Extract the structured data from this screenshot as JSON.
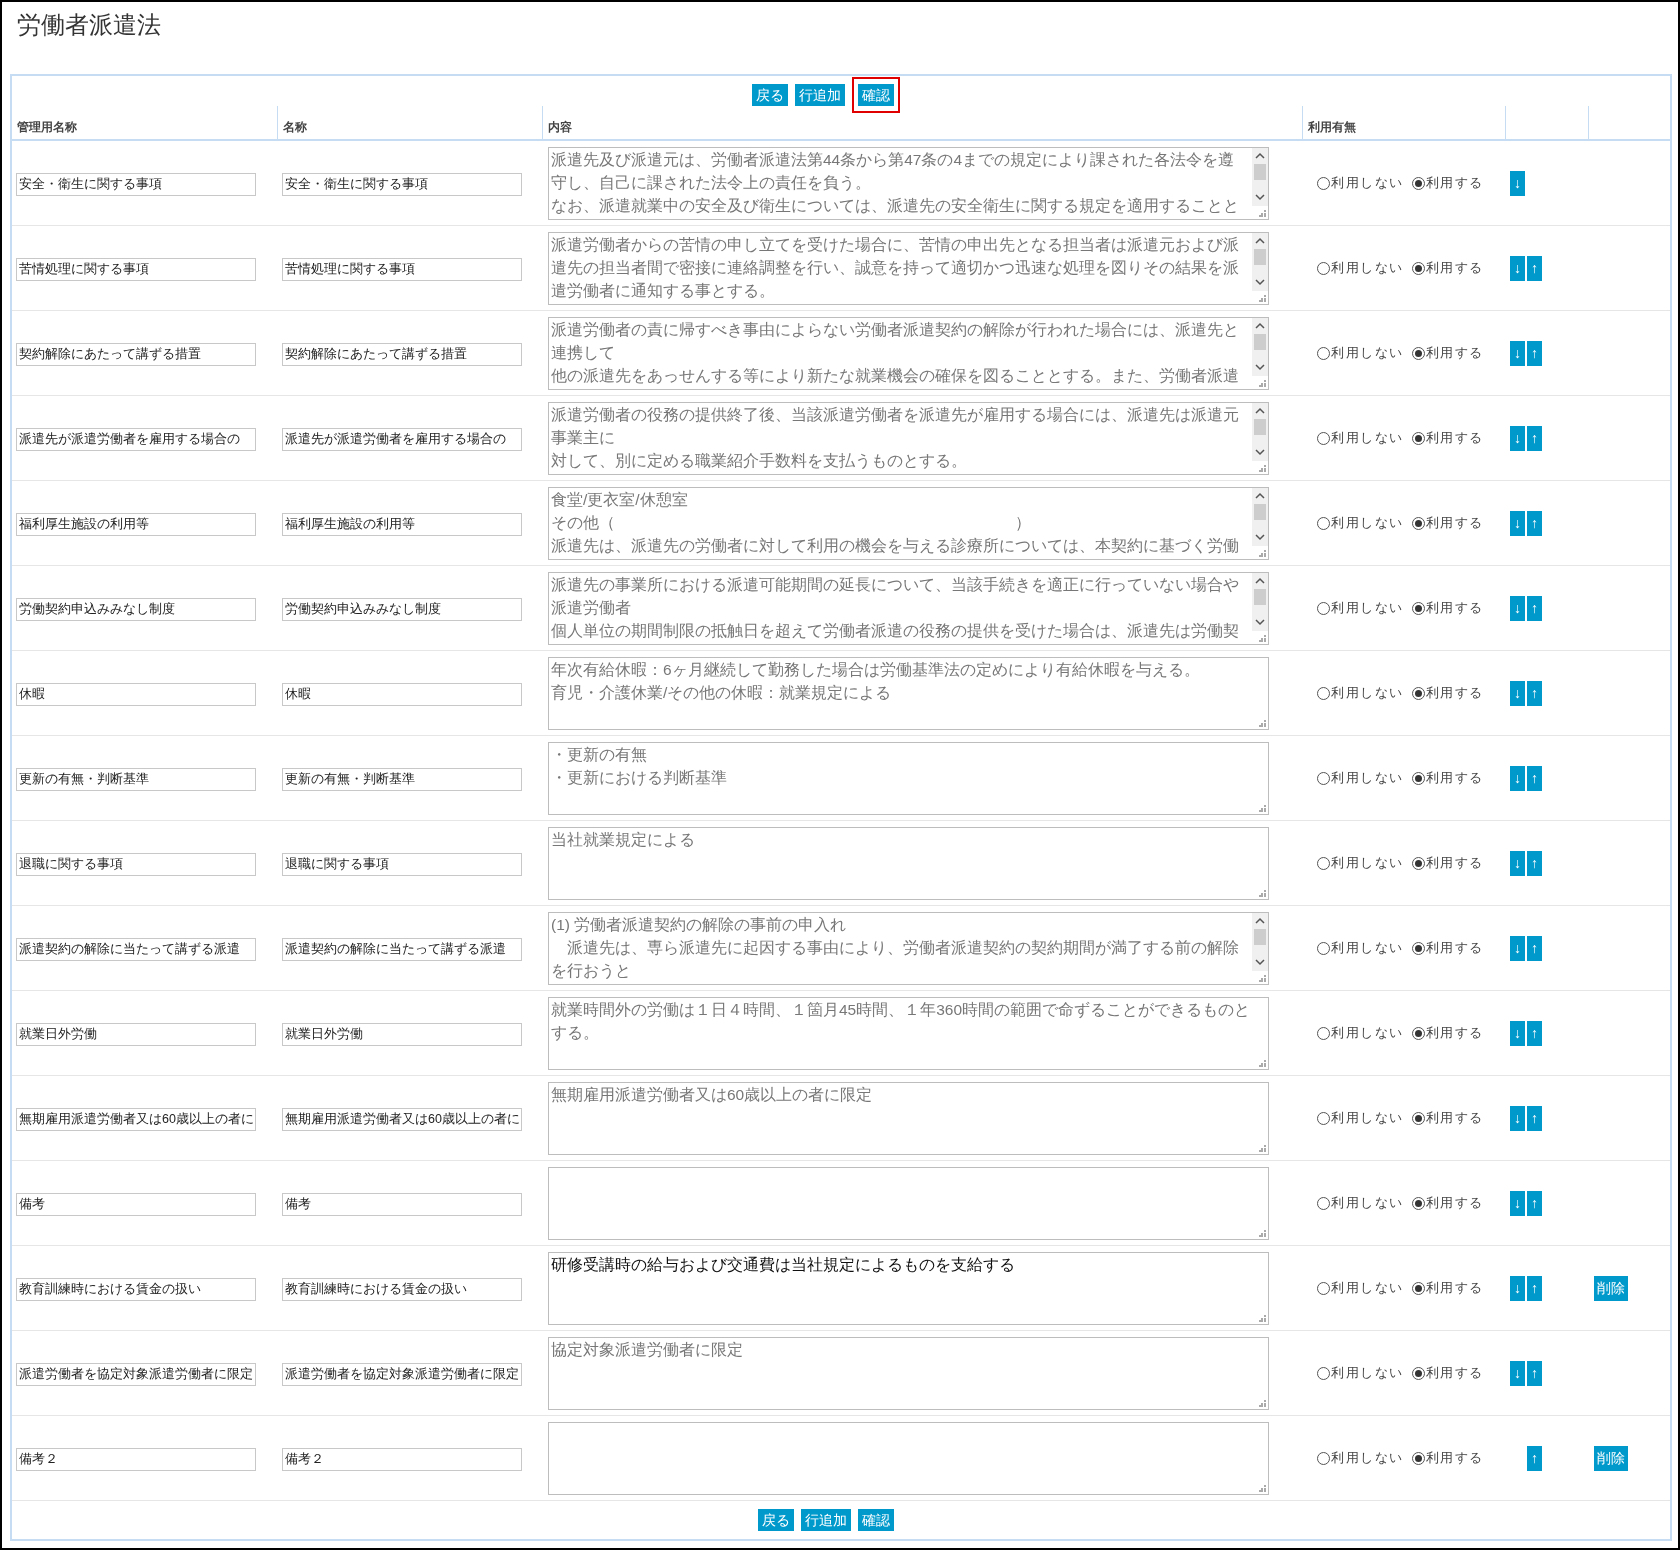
{
  "title": "労働者派遣法",
  "top_buttons": [
    {
      "label": "戻る",
      "highlighted": false
    },
    {
      "label": "行追加",
      "highlighted": false
    },
    {
      "label": "確認",
      "highlighted": true
    }
  ],
  "columns": [
    "管理用名称",
    "名称",
    "内容",
    "利用有無"
  ],
  "rows": [
    {
      "admin_name": "安全・衛生に関する事項",
      "name": "安全・衛生に関する事項",
      "content": {
        "lines": [
          "派遣先及び派遣元は、労働者派遣法第44条から第47条の4までの規定により課された各法令を遵",
          "守し、自己に課された法令上の責任を負う。",
          "なお、派遣就業中の安全及び衛生については、派遣先の安全衛生に関する規定を適用することと"
        ],
        "scrollbar": true,
        "dark": false
      },
      "usage": [
        {
          "label": "利用しない",
          "selected": false
        },
        {
          "label": "利用する",
          "selected": true
        }
      ],
      "down": "↓"
    },
    {
      "admin_name": "苦情処理に関する事項",
      "name": "苦情処理に関する事項",
      "content": {
        "lines": [
          "派遣労働者からの苦情の申し立てを受けた場合に、苦情の申出先となる担当者は派遣元および派",
          "遣先の担当者間で密接に連絡調整を行い、誠意を持って適切かつ迅速な処理を図りその結果を派",
          "遣労働者に通知する事とする。"
        ],
        "scrollbar": true,
        "dark": false
      },
      "usage": [
        {
          "label": "利用しない",
          "selected": false
        },
        {
          "label": "利用する",
          "selected": true
        }
      ],
      "down": "↓",
      "up": "↑"
    },
    {
      "admin_name": "契約解除にあたって講ずる措置",
      "name": "契約解除にあたって講ずる措置",
      "content": {
        "lines": [
          "派遣労働者の責に帰すべき事由によらない労働者派遣契約の解除が行われた場合には、派遣先と",
          "連携して",
          "他の派遣先をあっせんする等により新たな就業機会の確保を図ることとする。また、労働者派遣"
        ],
        "scrollbar": true,
        "dark": false
      },
      "usage": [
        {
          "label": "利用しない",
          "selected": false
        },
        {
          "label": "利用する",
          "selected": true
        }
      ],
      "down": "↓",
      "up": "↑"
    },
    {
      "admin_name": "派遣先が派遣労働者を雇用する場合の",
      "name": "派遣先が派遣労働者を雇用する場合の",
      "content": {
        "lines": [
          "派遣労働者の役務の提供終了後、当該派遣労働者を派遣先が雇用する場合には、派遣先は派遣元",
          "事業主に",
          "対して、別に定める職業紹介手数料を支払うものとする。"
        ],
        "scrollbar": true,
        "dark": false
      },
      "usage": [
        {
          "label": "利用しない",
          "selected": false
        },
        {
          "label": "利用する",
          "selected": true
        }
      ],
      "down": "↓",
      "up": "↑"
    },
    {
      "admin_name": "福利厚生施設の利用等",
      "name": "福利厚生施設の利用等",
      "content": {
        "lines": [
          "食堂/更衣室/休憩室",
          "その他（　　　　　　　　　　　　　　　　　　　　　　　　　）",
          "派遣先は、派遣先の労働者に対して利用の機会を与える診療所については、本契約に基づく労働"
        ],
        "scrollbar": true,
        "dark": false
      },
      "usage": [
        {
          "label": "利用しない",
          "selected": false
        },
        {
          "label": "利用する",
          "selected": true
        }
      ],
      "down": "↓",
      "up": "↑"
    },
    {
      "admin_name": "労働契約申込みみなし制度",
      "name": "労働契約申込みみなし制度",
      "content": {
        "lines": [
          "派遣先の事業所における派遣可能期間の延長について、当該手続きを適正に行っていない場合や",
          "派遣労働者",
          "個人単位の期間制限の抵触日を超えて労働者派遣の役務の提供を受けた場合は、派遣先は労働契"
        ],
        "scrollbar": true,
        "dark": false
      },
      "usage": [
        {
          "label": "利用しない",
          "selected": false
        },
        {
          "label": "利用する",
          "selected": true
        }
      ],
      "down": "↓",
      "up": "↑"
    },
    {
      "admin_name": "休暇",
      "name": "休暇",
      "content": {
        "lines": [
          "年次有給休暇：6ヶ月継続して勤務した場合は労働基準法の定めにより有給休暇を与える。",
          "育児・介護休業/その他の休暇：就業規定による"
        ],
        "scrollbar": false,
        "dark": false
      },
      "usage": [
        {
          "label": "利用しない",
          "selected": false
        },
        {
          "label": "利用する",
          "selected": true
        }
      ],
      "down": "↓",
      "up": "↑"
    },
    {
      "admin_name": "更新の有無・判断基準",
      "name": "更新の有無・判断基準",
      "content": {
        "lines": [
          "・更新の有無",
          "・更新における判断基準"
        ],
        "scrollbar": false,
        "dark": false
      },
      "usage": [
        {
          "label": "利用しない",
          "selected": false
        },
        {
          "label": "利用する",
          "selected": true
        }
      ],
      "down": "↓",
      "up": "↑"
    },
    {
      "admin_name": "退職に関する事項",
      "name": "退職に関する事項",
      "content": {
        "lines": [
          "当社就業規定による"
        ],
        "scrollbar": false,
        "dark": false
      },
      "usage": [
        {
          "label": "利用しない",
          "selected": false
        },
        {
          "label": "利用する",
          "selected": true
        }
      ],
      "down": "↓",
      "up": "↑"
    },
    {
      "admin_name": "派遣契約の解除に当たって講ずる派遣",
      "name": "派遣契約の解除に当たって講ずる派遣",
      "content": {
        "lines": [
          "(1) 労働者派遣契約の解除の事前の申入れ",
          "　派遣先は、専ら派遣先に起因する事由により、労働者派遣契約の契約期間が満了する前の解除",
          "を行おうと"
        ],
        "scrollbar": true,
        "dark": false
      },
      "usage": [
        {
          "label": "利用しない",
          "selected": false
        },
        {
          "label": "利用する",
          "selected": true
        }
      ],
      "down": "↓",
      "up": "↑"
    },
    {
      "admin_name": "就業日外労働",
      "name": "就業日外労働",
      "content": {
        "lines": [
          "就業時間外の労働は１日４時間、１箇月45時間、１年360時間の範囲で命ずることができるものと",
          "する。"
        ],
        "scrollbar": false,
        "dark": false
      },
      "usage": [
        {
          "label": "利用しない",
          "selected": false
        },
        {
          "label": "利用する",
          "selected": true
        }
      ],
      "down": "↓",
      "up": "↑"
    },
    {
      "admin_name": "無期雇用派遣労働者又は60歳以上の者に",
      "name": "無期雇用派遣労働者又は60歳以上の者に",
      "content": {
        "lines": [
          "無期雇用派遣労働者又は60歳以上の者に限定"
        ],
        "scrollbar": false,
        "dark": false
      },
      "usage": [
        {
          "label": "利用しない",
          "selected": false
        },
        {
          "label": "利用する",
          "selected": true
        }
      ],
      "down": "↓",
      "up": "↑"
    },
    {
      "admin_name": "備考",
      "name": "備考",
      "content": {
        "scrollbar": false
      },
      "usage": [
        {
          "label": "利用しない",
          "selected": false
        },
        {
          "label": "利用する",
          "selected": true
        }
      ],
      "down": "↓",
      "up": "↑"
    },
    {
      "admin_name": "教育訓練時における賃金の扱い",
      "name": "教育訓練時における賃金の扱い",
      "content": {
        "lines": [
          "研修受講時の給与および交通費は当社規定によるものを支給する"
        ],
        "scrollbar": false,
        "dark": true
      },
      "usage": [
        {
          "label": "利用しない",
          "selected": false
        },
        {
          "label": "利用する",
          "selected": true
        }
      ],
      "down": "↓",
      "up": "↑",
      "delete": "削除"
    },
    {
      "admin_name": "派遣労働者を協定対象派遣労働者に限定",
      "name": "派遣労働者を協定対象派遣労働者に限定",
      "content": {
        "lines": [
          "協定対象派遣労働者に限定"
        ],
        "scrollbar": false,
        "dark": false
      },
      "usage": [
        {
          "label": "利用しない",
          "selected": false
        },
        {
          "label": "利用する",
          "selected": true
        }
      ],
      "down": "↓",
      "up": "↑"
    },
    {
      "admin_name": "備考２",
      "name": "備考２",
      "content": {
        "scrollbar": false
      },
      "usage": [
        {
          "label": "利用しない",
          "selected": false
        },
        {
          "label": "利用する",
          "selected": true
        }
      ],
      "up": "↑",
      "delete": "削除"
    }
  ],
  "bottom_buttons": [
    {
      "label": "戻る",
      "highlighted": false
    },
    {
      "label": "行追加",
      "highlighted": false
    },
    {
      "label": "確認",
      "highlighted": false
    }
  ]
}
